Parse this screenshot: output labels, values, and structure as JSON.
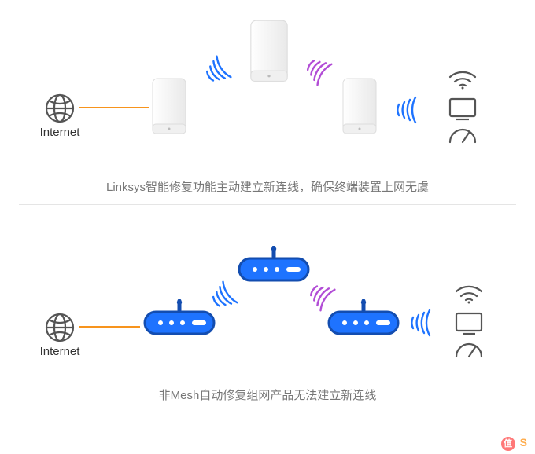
{
  "diagram_top": {
    "internet_label": "Internet",
    "caption": "Linksys智能修复功能主动建立新连线，确保终端装置上网无虞",
    "nodes": [
      "velop-node-1",
      "velop-node-2",
      "velop-node-3"
    ],
    "links": [
      {
        "type": "wire",
        "from": "internet",
        "to": "node1",
        "color": "#f7941d"
      },
      {
        "type": "wifi",
        "from": "node1",
        "to": "node2",
        "color": "#1e73ff"
      },
      {
        "type": "wifi",
        "from": "node2",
        "to": "node3",
        "color": "#b24dd6"
      },
      {
        "type": "wifi",
        "from": "node3",
        "to": "devices",
        "color": "#1e73ff"
      }
    ],
    "device_icons": [
      "wifi",
      "monitor",
      "gauge"
    ]
  },
  "diagram_bottom": {
    "internet_label": "Internet",
    "caption": "非Mesh自动修复组网产品无法建立新连线",
    "nodes": [
      "router-1",
      "router-2",
      "router-3"
    ],
    "links": [
      {
        "type": "wire",
        "from": "internet",
        "to": "node1",
        "color": "#f7941d"
      },
      {
        "type": "wifi",
        "from": "node1",
        "to": "node2",
        "color": "#1e73ff"
      },
      {
        "type": "wifi",
        "from": "node2",
        "to": "node3",
        "color": "#b24dd6"
      },
      {
        "type": "wifi",
        "from": "node3",
        "to": "devices",
        "color": "#1e73ff"
      }
    ],
    "device_icons": [
      "wifi",
      "monitor",
      "gauge"
    ]
  },
  "watermark": "S",
  "watermark_badge": "值"
}
